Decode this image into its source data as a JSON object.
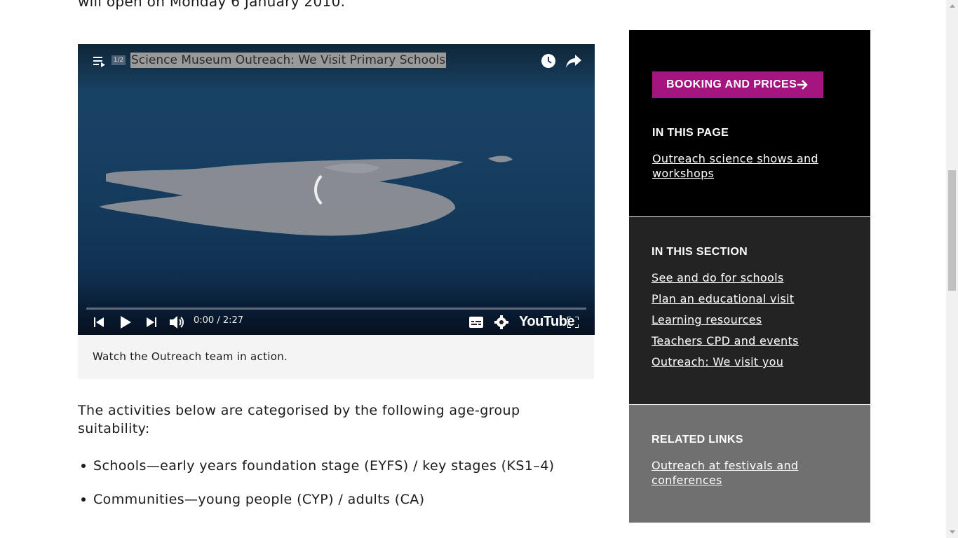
{
  "intro": {
    "text": "will open on Monday 6 January 2010."
  },
  "video": {
    "playlist_count": "1/2",
    "title": "Science Museum Outreach: We Visit Primary Schools",
    "time": "0:00 / 2:27",
    "brand": "YouTube",
    "progress": 0
  },
  "caption": "Watch the Outreach team in action.",
  "body": {
    "paragraph": "The activities below are categorised by the following age-group suitability:",
    "bullets": [
      "Schools—early years foundation stage (EYFS) / key stages (KS1–4)",
      "Communities—young people (CYP) / adults (CA)"
    ]
  },
  "sidebar": {
    "booking_button": "BOOKING AND PRICES",
    "in_this_page": {
      "heading": "IN THIS PAGE",
      "links": [
        "Outreach science shows and workshops"
      ]
    },
    "in_this_section": {
      "heading": "IN THIS SECTION",
      "links": [
        "See and do for schools",
        "Plan an educational visit",
        "Learning resources",
        "Teachers CPD and events",
        "Outreach: We visit you"
      ]
    },
    "related_links": {
      "heading": "RELATED LINKS",
      "links": [
        "Outreach at festivals and conferences"
      ]
    }
  },
  "colors": {
    "accent": "#a4157f",
    "sidebar_page_bg": "#000000",
    "sidebar_section_bg": "#232323",
    "sidebar_related_bg": "#707070"
  }
}
